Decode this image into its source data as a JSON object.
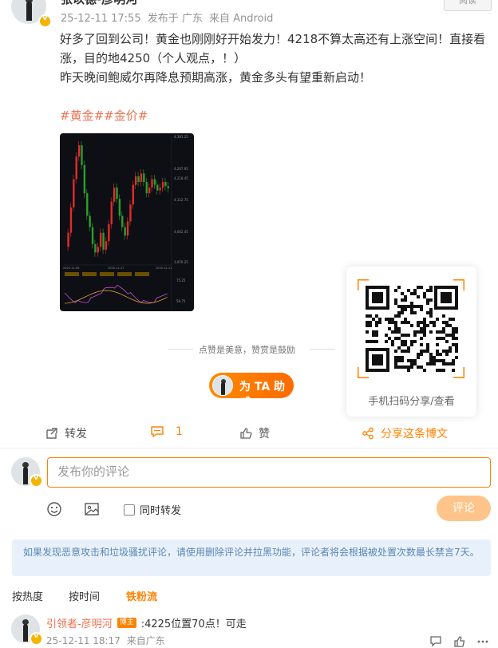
{
  "post": {
    "author": "张以德-彦明河",
    "timestamp": "25-12-11 17:55",
    "location": "发布于 广东",
    "source": "来自 Android",
    "follow_label": "阅读",
    "text_line1": "好多了回到公司！黄金也刚刚好开始发力！4218不算太高还有上涨空间！直接看",
    "text_line2": "涨，目的地4250（个人观点，！）",
    "text_line3": "昨天晚间鲍威尔再降息预期高涨，黄金多头有望重新启动！",
    "tags": "#黄金##金价#"
  },
  "chart_data": {
    "type": "candlestick",
    "price_labels": [
      "4,381.25",
      "4,267.95",
      "4,218.45",
      "4,112.75",
      "4,002.45",
      "3,976.25"
    ],
    "indicator_labels": [
      "75.25",
      "59.75"
    ],
    "date_labels": [
      "2025-11-06",
      "2025-11-17",
      "2025-12-11"
    ],
    "annotations": [
      "4,381.25",
      "3,976.25"
    ],
    "colors": {
      "up": "#e12c2c",
      "down": "#2ca02c",
      "background": "#0d0f14"
    }
  },
  "support": {
    "caption": "点赞是美意，赞赏是鼓励",
    "button_label": "为 TA 助威"
  },
  "share_card": {
    "caption": "手机扫码分享/查看"
  },
  "actions": {
    "repost_label": "转发",
    "comment_count": "1",
    "like_label": "赞",
    "share_label": "分享这条博文"
  },
  "compose": {
    "placeholder": "发布你的评论",
    "repost_toggle_label": "同时转发",
    "submit_label": "评论"
  },
  "notice": {
    "text": "如果发现恶意攻击和垃圾骚扰评论，请使用删除评论并拉黑功能，评论者将会根据被处置次数最长禁言7天。"
  },
  "sort": {
    "hot": "按热度",
    "time": "按时间",
    "fans": "铁粉流"
  },
  "comment": {
    "author": "引领者-彦明河",
    "badge": "博主",
    "text": ":4225位置70点！可走",
    "timestamp": "25-12-11 18:17",
    "source": "来自广东"
  },
  "colors": {
    "accent": "#ff8200",
    "tag": "#eb7350",
    "notice_bg": "#e8f1fb"
  }
}
